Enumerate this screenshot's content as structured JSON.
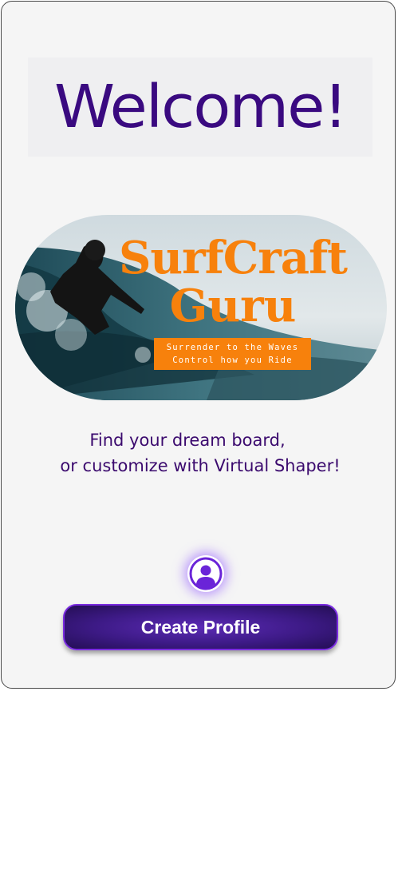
{
  "welcome": {
    "title": "Welcome!"
  },
  "banner": {
    "brand_line1": "SurfCraft",
    "brand_line2": "Guru",
    "tagline_line1": "Surrender to the Waves",
    "tagline_line2": "Control how you Ride"
  },
  "subtitle": {
    "line1": "Find your dream board,",
    "line2": "or customize with Virtual Shaper!"
  },
  "profile": {
    "icon": "user-circle-icon",
    "button_label": "Create Profile"
  },
  "colors": {
    "primary": "#3a0a80",
    "accent": "#f7810c",
    "button": "#3d1a86",
    "background": "#f5f5f5"
  }
}
